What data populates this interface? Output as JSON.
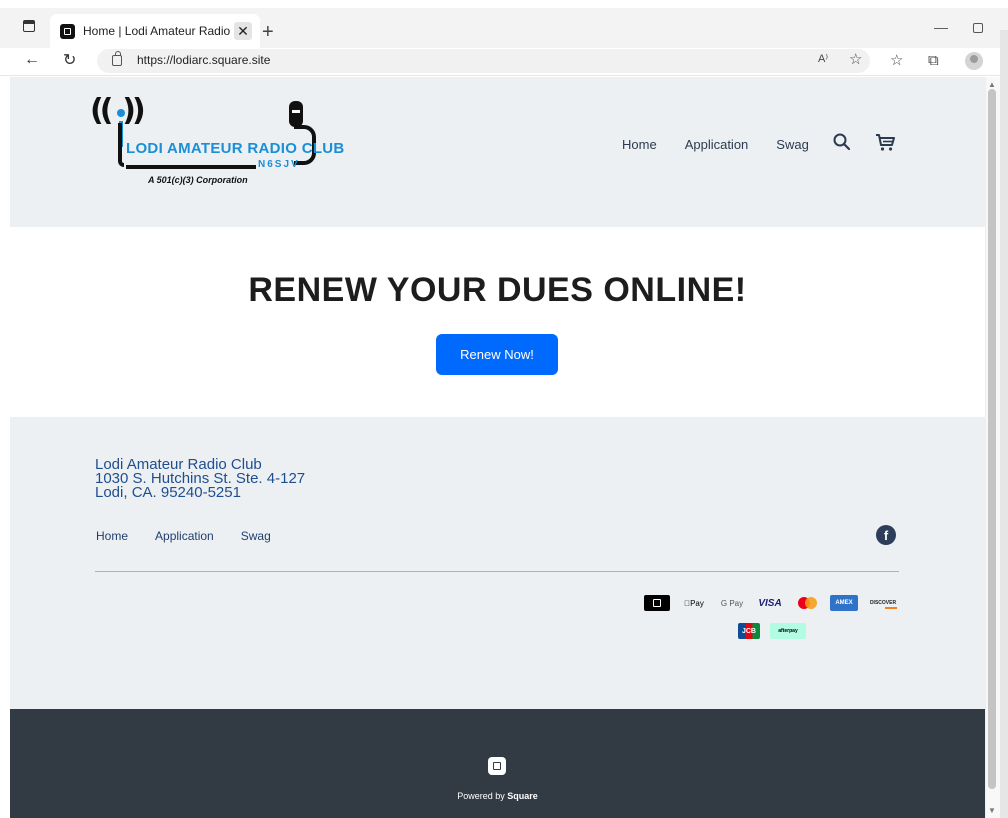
{
  "browser": {
    "tab_title": "Home | Lodi Amateur Radio Club",
    "tab_close": "✕",
    "new_tab": "+",
    "url": "https://lodiarc.square.site",
    "read_aloud": "A⁾"
  },
  "header": {
    "logo": {
      "name": "LODI AMATEUR RADIO CLUB",
      "callsign": "N6SJV",
      "tagline": "A 501(c)(3) Corporation"
    },
    "nav": [
      "Home",
      "Application",
      "Swag"
    ]
  },
  "hero": {
    "title": "RENEW YOUR DUES ONLINE!",
    "button_label": "Renew Now!"
  },
  "footer": {
    "address": {
      "line1": "Lodi Amateur Radio Club",
      "line2": "1030 S. Hutchins St. Ste. 4-127",
      "line3": "Lodi, CA. 95240-5251"
    },
    "nav": [
      "Home",
      "Application",
      "Swag"
    ],
    "facebook": "f",
    "payments": {
      "apple_pay": "Pay",
      "google_pay": "G Pay",
      "visa": "VISA",
      "amex": "AMEX",
      "discover": "DISCOVER",
      "jcb": "JCB",
      "afterpay": "afterpay"
    }
  },
  "powered_by": {
    "prefix": "Powered by ",
    "brand": "Square"
  },
  "colors": {
    "accent": "#006aff",
    "header_bg": "#ecf0f3",
    "dark_footer": "#323a43",
    "logo_blue": "#1a8fd6"
  }
}
